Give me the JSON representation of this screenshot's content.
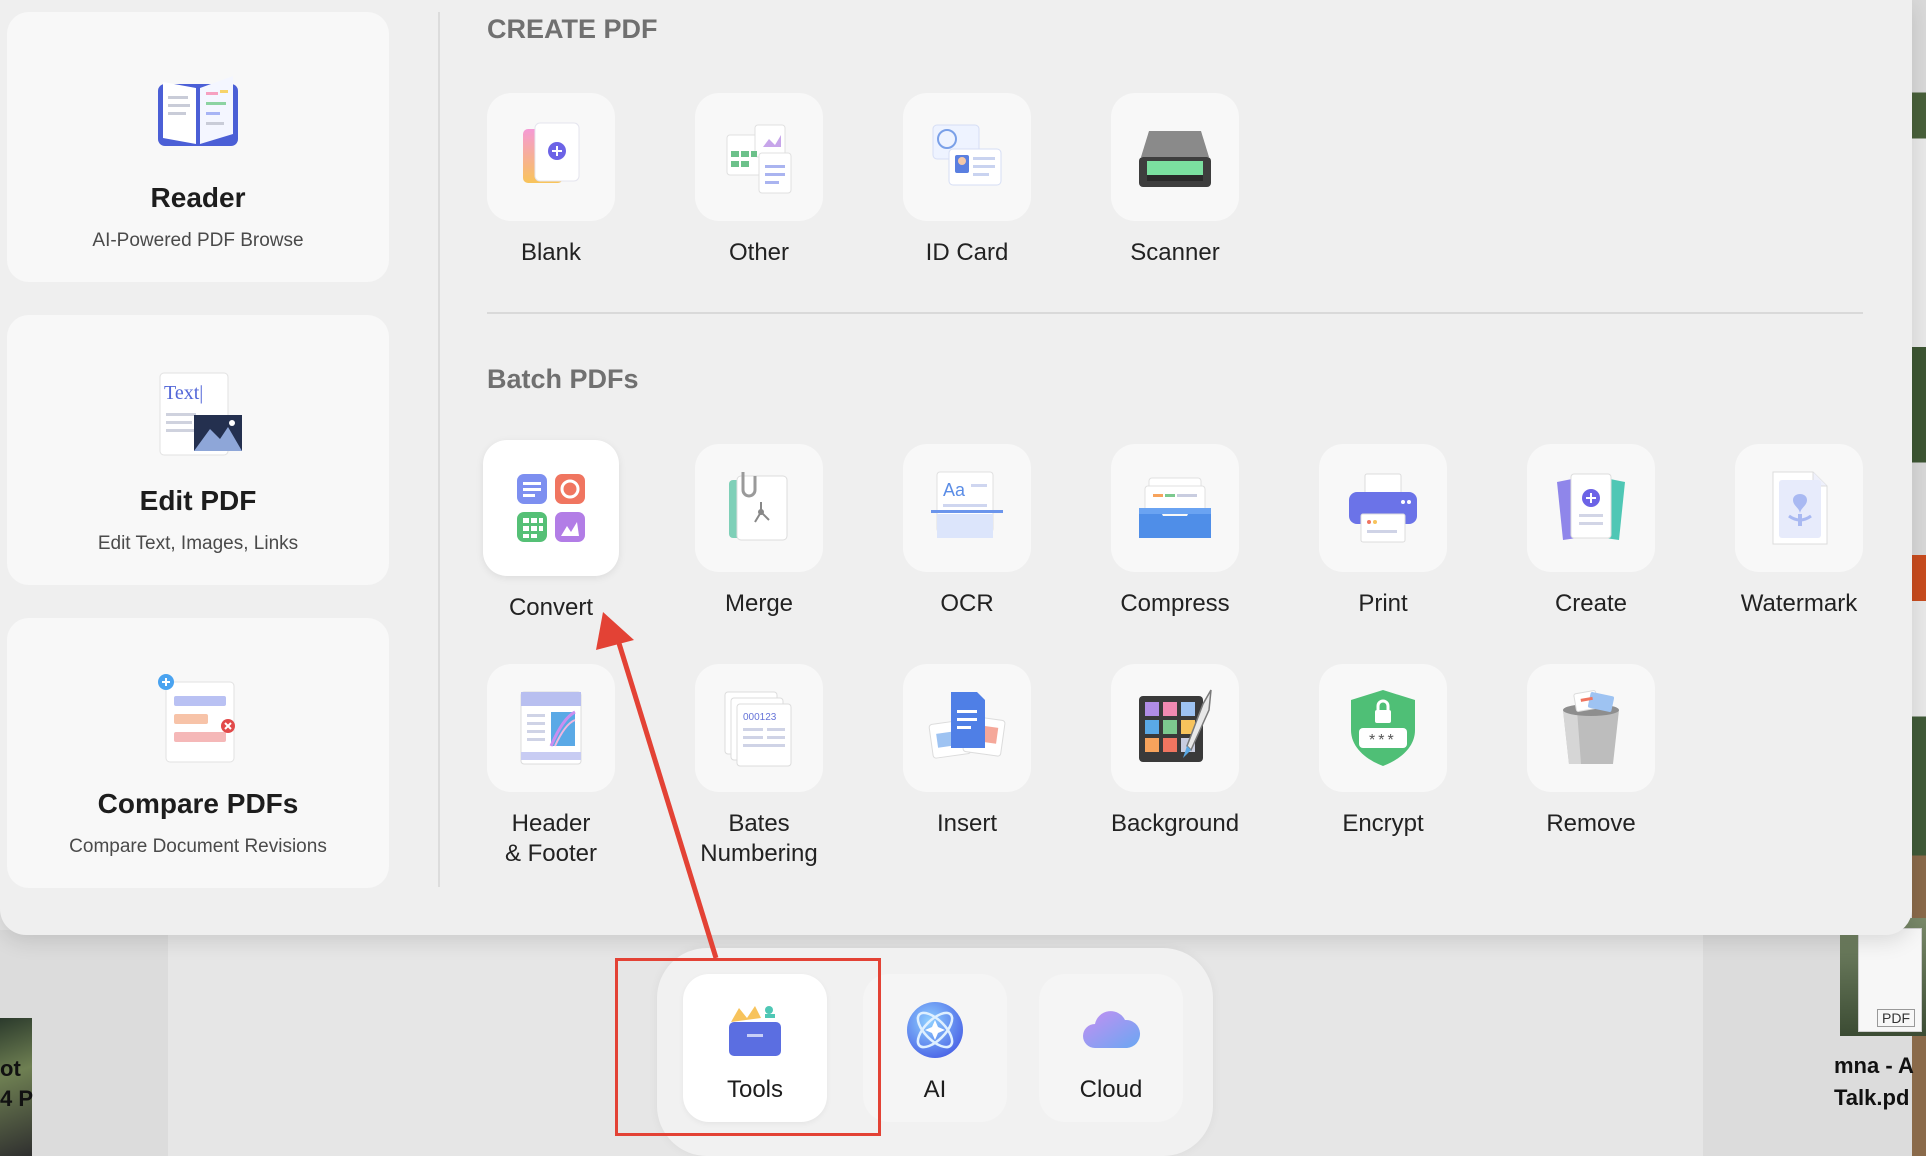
{
  "cards": [
    {
      "title": "Reader",
      "subtitle": "AI-Powered PDF Browse",
      "icon": "book-icon"
    },
    {
      "title": "Edit PDF",
      "subtitle": "Edit Text, Images, Links",
      "icon": "edit-text-icon",
      "art_text": "Text|"
    },
    {
      "title": "Compare PDFs",
      "subtitle": "Compare Document Revisions",
      "icon": "compare-icon"
    }
  ],
  "create_pdf": {
    "heading": "CREATE PDF",
    "tools": [
      {
        "label": "Blank",
        "icon": "blank-page-icon"
      },
      {
        "label": "Other",
        "icon": "other-files-icon"
      },
      {
        "label": "ID Card",
        "icon": "id-card-icon"
      },
      {
        "label": "Scanner",
        "icon": "scanner-icon"
      }
    ]
  },
  "batch_pdfs": {
    "heading": "Batch PDFs",
    "tools": [
      {
        "label": "Convert",
        "icon": "convert-icon",
        "selected": true
      },
      {
        "label": "Merge",
        "icon": "merge-icon"
      },
      {
        "label": "OCR",
        "icon": "ocr-icon",
        "art_text": "Aa"
      },
      {
        "label": "Compress",
        "icon": "compress-icon"
      },
      {
        "label": "Print",
        "icon": "print-icon"
      },
      {
        "label": "Create",
        "icon": "create-icon"
      },
      {
        "label": "Watermark",
        "icon": "watermark-icon"
      },
      {
        "label": "Header\n& Footer",
        "icon": "header-footer-icon"
      },
      {
        "label": "Bates\nNumbering",
        "icon": "bates-numbering-icon",
        "art_text": "000123"
      },
      {
        "label": "Insert",
        "icon": "insert-icon"
      },
      {
        "label": "Background",
        "icon": "background-icon"
      },
      {
        "label": "Encrypt",
        "icon": "encrypt-icon",
        "art_text": "***"
      },
      {
        "label": "Remove",
        "icon": "trash-icon"
      }
    ]
  },
  "dock": [
    {
      "label": "Tools",
      "icon": "tools-icon",
      "active": true
    },
    {
      "label": "AI",
      "icon": "ai-icon"
    },
    {
      "label": "Cloud",
      "icon": "cloud-icon"
    }
  ],
  "background": {
    "left_label": "ot\n4 P",
    "right_label": "mna - A\nTalk.pd",
    "right_doc_badge": "PDF"
  },
  "colors": {
    "annotation_red": "#e34235",
    "accent_blue": "#5b6ee1",
    "panel_bg": "#efefef"
  }
}
